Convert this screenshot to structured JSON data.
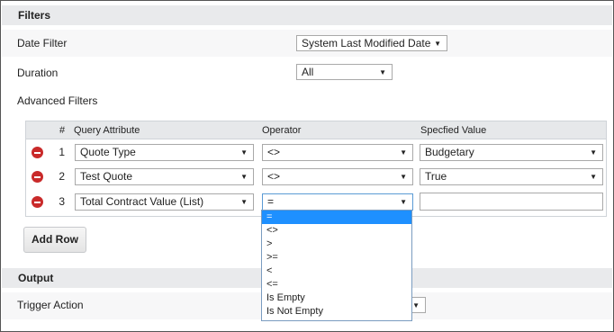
{
  "filters": {
    "section_title": "Filters",
    "date_filter": {
      "label": "Date Filter",
      "value": "System Last Modified Date"
    },
    "duration": {
      "label": "Duration",
      "value": "All"
    },
    "advanced_label": "Advanced Filters",
    "grid": {
      "headers": [
        "#",
        "Query Attribute",
        "Operator",
        "Specfied Value"
      ],
      "rows": [
        {
          "num": "1",
          "attribute": "Quote Type",
          "operator": "<>",
          "value": "Budgetary"
        },
        {
          "num": "2",
          "attribute": "Test Quote",
          "operator": "<>",
          "value": "True"
        },
        {
          "num": "3",
          "attribute": "Total Contract Value (List)",
          "operator": "=",
          "value": ""
        }
      ]
    },
    "add_row_label": "Add Row"
  },
  "operator_dropdown": {
    "selected": "=",
    "options": [
      "=",
      "<>",
      ">",
      ">=",
      "<",
      "<=",
      "Is Empty",
      "Is Not Empty"
    ]
  },
  "output": {
    "section_title": "Output",
    "trigger_action": {
      "label": "Trigger Action"
    }
  },
  "icons": {
    "delete": "minus-circle-icon",
    "dropdown": "chevron-down-icon"
  },
  "colors": {
    "delete_red": "#c92a2a",
    "selection_blue": "#1e90ff",
    "section_bg": "#e9eaec"
  }
}
